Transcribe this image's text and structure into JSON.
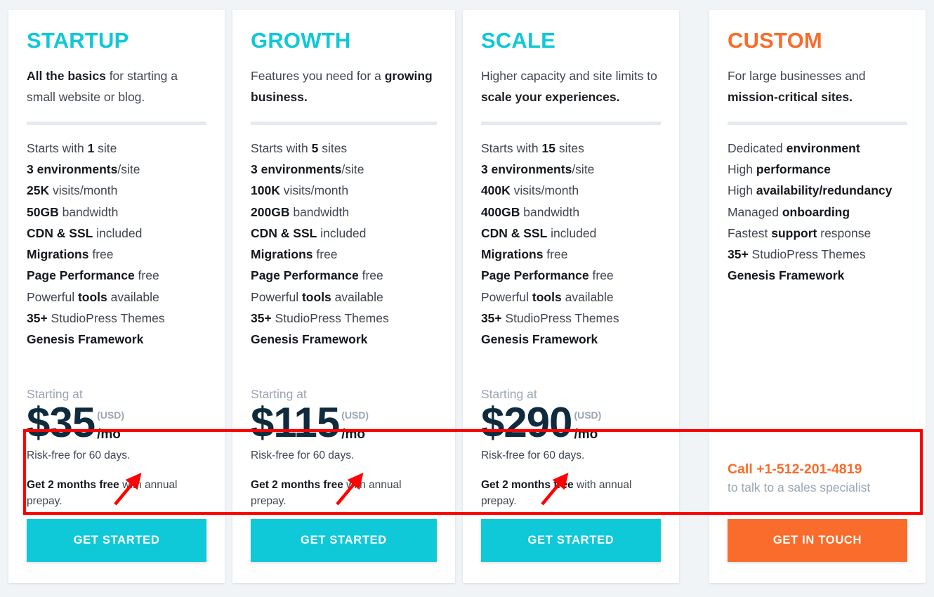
{
  "page": {
    "background_color": "#f1f4f7",
    "accent_cyan": "#0fc8d8",
    "accent_orange": "#f96c2b",
    "price_color": "#0f2b3d",
    "annotation_color": "#ff0000"
  },
  "plans": [
    {
      "id": "startup",
      "title": "STARTUP",
      "title_color": "#0fc8d8",
      "desc_parts": [
        {
          "text": "All the basics",
          "bold": true
        },
        {
          "text": " for starting a small website or blog.",
          "bold": false
        }
      ],
      "features": [
        [
          {
            "text": "Starts with ",
            "bold": false
          },
          {
            "text": "1",
            "bold": true
          },
          {
            "text": " site",
            "bold": false
          }
        ],
        [
          {
            "text": "3 environments",
            "bold": true
          },
          {
            "text": "/site",
            "bold": false
          }
        ],
        [
          {
            "text": "25K",
            "bold": true
          },
          {
            "text": " visits/month",
            "bold": false
          }
        ],
        [
          {
            "text": "50GB",
            "bold": true
          },
          {
            "text": " bandwidth",
            "bold": false
          }
        ],
        [
          {
            "text": "CDN & SSL",
            "bold": true
          },
          {
            "text": " included",
            "bold": false
          }
        ],
        [
          {
            "text": "Migrations",
            "bold": true
          },
          {
            "text": " free",
            "bold": false
          }
        ],
        [
          {
            "text": "Page Performance",
            "bold": true
          },
          {
            "text": " free",
            "bold": false
          }
        ],
        [
          {
            "text": "Powerful ",
            "bold": false
          },
          {
            "text": "tools",
            "bold": true
          },
          {
            "text": " available",
            "bold": false
          }
        ],
        [
          {
            "text": "35+",
            "bold": true
          },
          {
            "text": " StudioPress Themes",
            "bold": false
          }
        ],
        [
          {
            "text": "Genesis Framework",
            "bold": true
          }
        ]
      ],
      "starting_at": "Starting at",
      "price": "$35",
      "currency": "(USD)",
      "per": "/mo",
      "risk_note": "Risk-free for 60 days.",
      "promo_parts": [
        {
          "text": "Get 2 months free",
          "bold": true
        },
        {
          "text": " with annual prepay.",
          "bold": false
        }
      ],
      "cta_label": "GET STARTED",
      "cta_style": "cyan"
    },
    {
      "id": "growth",
      "title": "GROWTH",
      "title_color": "#0fc8d8",
      "desc_parts": [
        {
          "text": "Features you need for a ",
          "bold": false
        },
        {
          "text": "growing business.",
          "bold": true
        }
      ],
      "features": [
        [
          {
            "text": "Starts with ",
            "bold": false
          },
          {
            "text": "5",
            "bold": true
          },
          {
            "text": " sites",
            "bold": false
          }
        ],
        [
          {
            "text": "3 environments",
            "bold": true
          },
          {
            "text": "/site",
            "bold": false
          }
        ],
        [
          {
            "text": "100K",
            "bold": true
          },
          {
            "text": " visits/month",
            "bold": false
          }
        ],
        [
          {
            "text": "200GB",
            "bold": true
          },
          {
            "text": " bandwidth",
            "bold": false
          }
        ],
        [
          {
            "text": "CDN & SSL",
            "bold": true
          },
          {
            "text": " included",
            "bold": false
          }
        ],
        [
          {
            "text": "Migrations",
            "bold": true
          },
          {
            "text": " free",
            "bold": false
          }
        ],
        [
          {
            "text": "Page Performance",
            "bold": true
          },
          {
            "text": " free",
            "bold": false
          }
        ],
        [
          {
            "text": "Powerful ",
            "bold": false
          },
          {
            "text": "tools",
            "bold": true
          },
          {
            "text": " available",
            "bold": false
          }
        ],
        [
          {
            "text": "35+",
            "bold": true
          },
          {
            "text": " StudioPress Themes",
            "bold": false
          }
        ],
        [
          {
            "text": "Genesis Framework",
            "bold": true
          }
        ]
      ],
      "starting_at": "Starting at",
      "price": "$115",
      "currency": "(USD)",
      "per": "/mo",
      "risk_note": "Risk-free for 60 days.",
      "promo_parts": [
        {
          "text": "Get 2 months free",
          "bold": true
        },
        {
          "text": " with annual prepay.",
          "bold": false
        }
      ],
      "cta_label": "GET STARTED",
      "cta_style": "cyan"
    },
    {
      "id": "scale",
      "title": "SCALE",
      "title_color": "#0fc8d8",
      "desc_parts": [
        {
          "text": "Higher capacity and site limits to ",
          "bold": false
        },
        {
          "text": "scale your experiences.",
          "bold": true
        }
      ],
      "features": [
        [
          {
            "text": "Starts with ",
            "bold": false
          },
          {
            "text": "15",
            "bold": true
          },
          {
            "text": " sites",
            "bold": false
          }
        ],
        [
          {
            "text": "3 environments",
            "bold": true
          },
          {
            "text": "/site",
            "bold": false
          }
        ],
        [
          {
            "text": "400K",
            "bold": true
          },
          {
            "text": " visits/month",
            "bold": false
          }
        ],
        [
          {
            "text": "400GB",
            "bold": true
          },
          {
            "text": " bandwidth",
            "bold": false
          }
        ],
        [
          {
            "text": "CDN & SSL",
            "bold": true
          },
          {
            "text": " included",
            "bold": false
          }
        ],
        [
          {
            "text": "Migrations",
            "bold": true
          },
          {
            "text": " free",
            "bold": false
          }
        ],
        [
          {
            "text": "Page Performance",
            "bold": true
          },
          {
            "text": " free",
            "bold": false
          }
        ],
        [
          {
            "text": "Powerful ",
            "bold": false
          },
          {
            "text": "tools",
            "bold": true
          },
          {
            "text": " available",
            "bold": false
          }
        ],
        [
          {
            "text": "35+",
            "bold": true
          },
          {
            "text": " StudioPress Themes",
            "bold": false
          }
        ],
        [
          {
            "text": "Genesis Framework",
            "bold": true
          }
        ]
      ],
      "starting_at": "Starting at",
      "price": "$290",
      "currency": "(USD)",
      "per": "/mo",
      "risk_note": "Risk-free for 60 days.",
      "promo_parts": [
        {
          "text": "Get 2 months free",
          "bold": true
        },
        {
          "text": " with annual prepay.",
          "bold": false
        }
      ],
      "cta_label": "GET STARTED",
      "cta_style": "cyan"
    },
    {
      "id": "custom",
      "title": "CUSTOM",
      "title_color": "#f96c2b",
      "desc_parts": [
        {
          "text": "For large businesses and ",
          "bold": false
        },
        {
          "text": "mission-critical sites.",
          "bold": true
        }
      ],
      "features": [
        [
          {
            "text": "Dedicated ",
            "bold": false
          },
          {
            "text": "environment",
            "bold": true
          }
        ],
        [
          {
            "text": "High ",
            "bold": false
          },
          {
            "text": "performance",
            "bold": true
          }
        ],
        [
          {
            "text": "High ",
            "bold": false
          },
          {
            "text": "availability/redundancy",
            "bold": true
          }
        ],
        [
          {
            "text": "Managed ",
            "bold": false
          },
          {
            "text": "onboarding",
            "bold": true
          }
        ],
        [
          {
            "text": "Fastest ",
            "bold": false
          },
          {
            "text": "support",
            "bold": true
          },
          {
            "text": " response",
            "bold": false
          }
        ],
        [
          {
            "text": "35+",
            "bold": true
          },
          {
            "text": " StudioPress Themes",
            "bold": false
          }
        ],
        [
          {
            "text": "Genesis Framework",
            "bold": true
          }
        ]
      ],
      "contact_call": "Call +1-512-201-4819",
      "contact_sub": "to talk to a sales specialist",
      "cta_label": "GET IN TOUCH",
      "cta_style": "orange"
    }
  ],
  "annotation": {
    "box_label": "highlight-box-promo-row",
    "arrow_label": "arrow-pointing-to-promo",
    "arrow_count": 3
  }
}
